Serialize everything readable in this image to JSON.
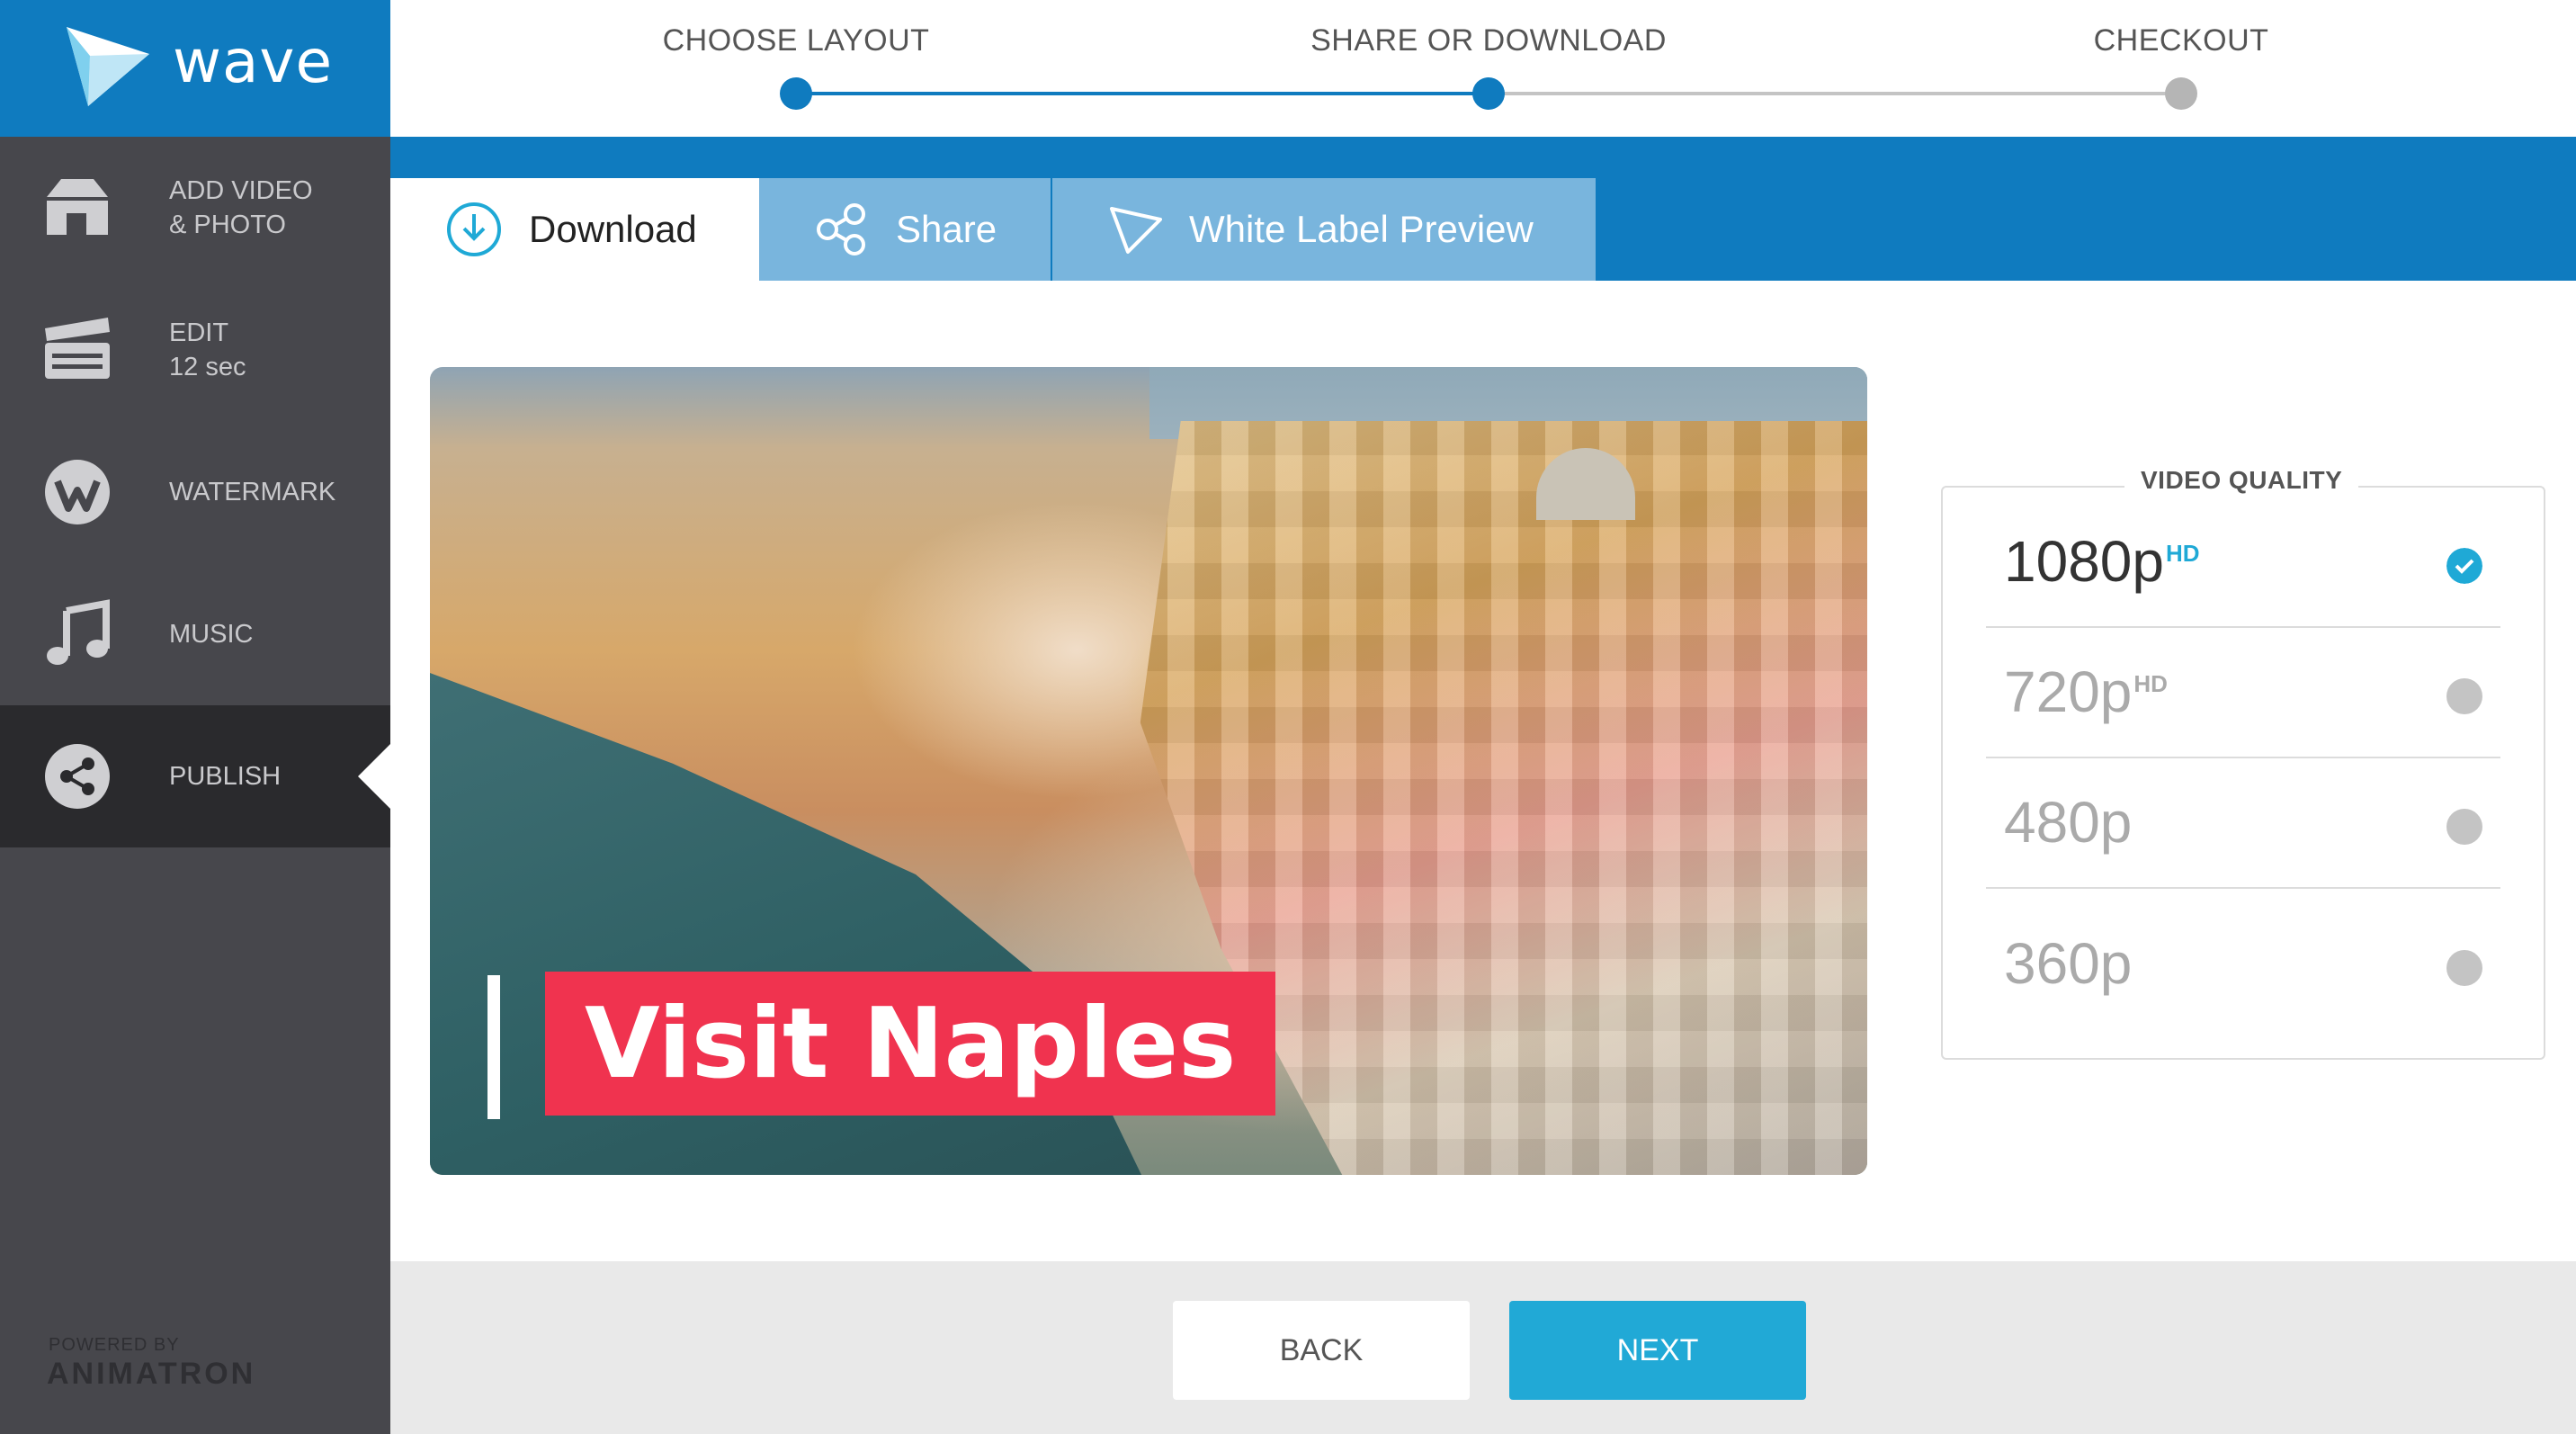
{
  "app": {
    "brand": "wave",
    "powered_by": "POWERED BY",
    "powered_company": "ANIMATRON"
  },
  "sidebar": {
    "items": [
      {
        "label": "ADD VIDEO\n& PHOTO",
        "icon": "home-icon"
      },
      {
        "label": "EDIT\n12 sec",
        "icon": "clapperboard-icon"
      },
      {
        "label": "WATERMARK",
        "icon": "watermark-w-icon"
      },
      {
        "label": "MUSIC",
        "icon": "music-note-icon"
      },
      {
        "label": "PUBLISH",
        "icon": "share-icon",
        "active": true
      }
    ]
  },
  "steps": {
    "items": [
      {
        "label": "CHOOSE LAYOUT",
        "state": "done"
      },
      {
        "label": "SHARE OR DOWNLOAD",
        "state": "current"
      },
      {
        "label": "CHECKOUT",
        "state": "pending"
      }
    ],
    "colors": {
      "done": "#0f7bbf",
      "pending": "#b5b5b5"
    }
  },
  "tabs": {
    "download": "Download",
    "share": "Share",
    "white_label": "White Label Preview",
    "active": "download"
  },
  "preview": {
    "caption": "Visit Naples"
  },
  "video_quality": {
    "title": "VIDEO QUALITY",
    "options": [
      {
        "res": "1080p",
        "hd": "HD",
        "selected": true
      },
      {
        "res": "720p",
        "hd": "HD",
        "selected": false
      },
      {
        "res": "480p",
        "hd": "",
        "selected": false
      },
      {
        "res": "360p",
        "hd": "",
        "selected": false
      }
    ]
  },
  "footer": {
    "back": "BACK",
    "next": "NEXT"
  },
  "colors": {
    "brand": "#0f7bbf",
    "accent": "#21a9d6",
    "caption_bg": "#f0334f",
    "sidebar": "#47474c"
  }
}
